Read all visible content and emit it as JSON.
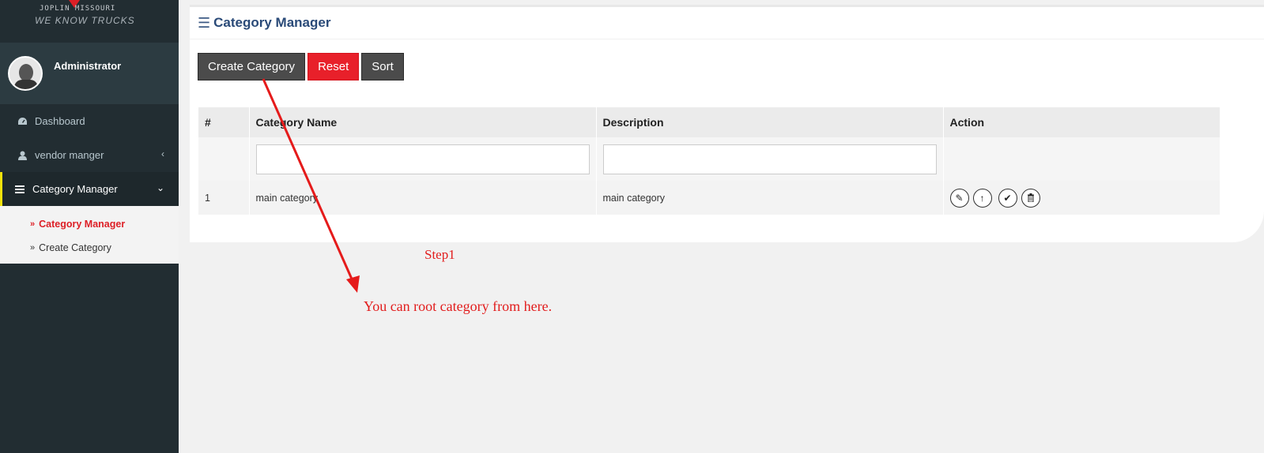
{
  "logo": {
    "line1": "JOPLIN MISSOURI",
    "line2": "WE KNOW TRUCKS"
  },
  "user": {
    "name": "Administrator"
  },
  "sidebar": {
    "items": [
      {
        "label": "Dashboard",
        "icon": "dashboard-icon"
      },
      {
        "label": "vendor manger",
        "icon": "user-icon"
      },
      {
        "label": "Category Manager",
        "icon": "bars-icon"
      }
    ],
    "submenu": [
      {
        "label": "Category Manager"
      },
      {
        "label": "Create Category"
      }
    ]
  },
  "main": {
    "title": "Category Manager",
    "buttons": {
      "create": "Create Category",
      "reset": "Reset",
      "sort": "Sort"
    },
    "table": {
      "headers": [
        "#",
        "Category Name",
        "Description",
        "Action"
      ],
      "rows": [
        {
          "num": "1",
          "name": "main category",
          "description": "main category"
        }
      ]
    }
  },
  "annotations": {
    "step": "Step1",
    "note": "You can root category from here."
  },
  "colors": {
    "accent_red": "#e8202a",
    "title_blue": "#2a4a78",
    "sidebar": "#222d32",
    "active_marker": "#f3e20b"
  }
}
